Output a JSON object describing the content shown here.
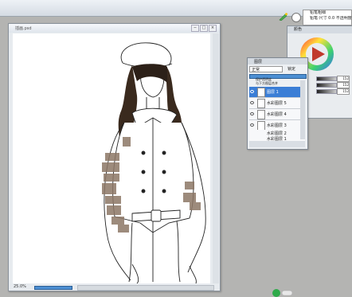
{
  "menubar": {
    "items": [
      "",
      "",
      "",
      ""
    ]
  },
  "brush": {
    "line1": "铅笔粗细",
    "line2": "铅笔·尺寸 0.0 不透明度 100"
  },
  "canvas_window": {
    "title": "插画.psd",
    "zoom": "25.0%",
    "btn_min": "−",
    "btn_max": "□",
    "btn_close": "×"
  },
  "color_panel": {
    "title": "颜色",
    "values": [
      "152",
      "152",
      "152"
    ],
    "accent": "#c0392b"
  },
  "layer_panel": {
    "title": "图层",
    "blend_mode": "正常",
    "lock": "锁定",
    "options": [
      "保护透明度",
      "与下方图层合并"
    ],
    "layers": [
      {
        "name": "图层 1",
        "selected": true
      },
      {
        "name": "水彩图层 5",
        "selected": false
      },
      {
        "name": "水彩图层 4",
        "selected": false
      },
      {
        "name": "水彩图层 3",
        "selected": false
      },
      {
        "name": "水彩图层 2",
        "selected": false
      },
      {
        "name": "水彩图层 1",
        "selected": false
      }
    ]
  },
  "colors": {
    "selected_layer": "#3b7ed6",
    "coat_pattern": "#8d7766",
    "hair": "#3a2a1e"
  }
}
